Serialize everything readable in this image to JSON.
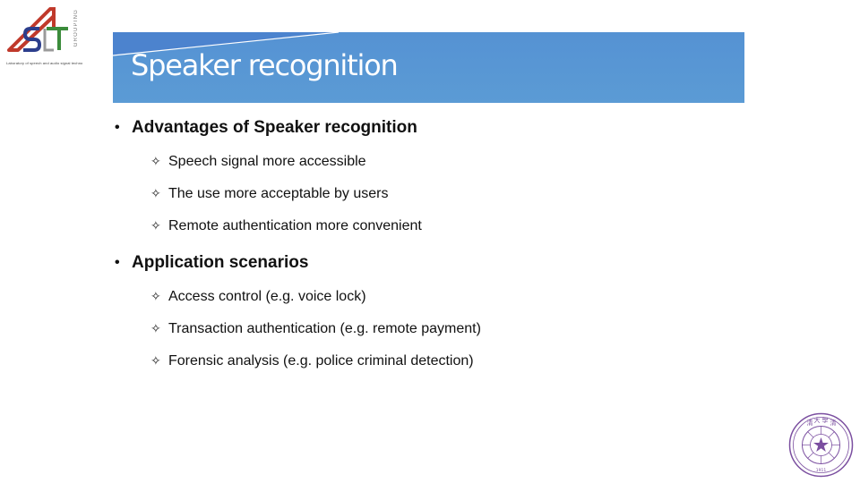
{
  "logo": {
    "name": "AST",
    "vertical_text": "GROUPING",
    "caption": "Laboratory of speech and audio signal technology",
    "colors": {
      "red": "#c0392b",
      "blue": "#2c3e8c",
      "green": "#3b8c3b",
      "gray": "#9a9a9a"
    }
  },
  "slide": {
    "title": "Speaker recognition",
    "banner_color": "#5b9bd5",
    "sections": [
      {
        "heading": "Advantages of Speaker recognition",
        "items": [
          "Speech signal more accessible",
          "The use more acceptable by users",
          "Remote authentication more convenient"
        ]
      },
      {
        "heading": "Application scenarios",
        "items": [
          "Access control (e.g. voice lock)",
          "Transaction authentication (e.g. remote payment)",
          "Forensic analysis (e.g. police criminal detection)"
        ]
      }
    ],
    "bullet_glyph": "•",
    "sub_bullet_glyph": "✧"
  },
  "seal": {
    "name": "Tsinghua University seal",
    "year": "1911",
    "color": "#7b4fa0"
  }
}
